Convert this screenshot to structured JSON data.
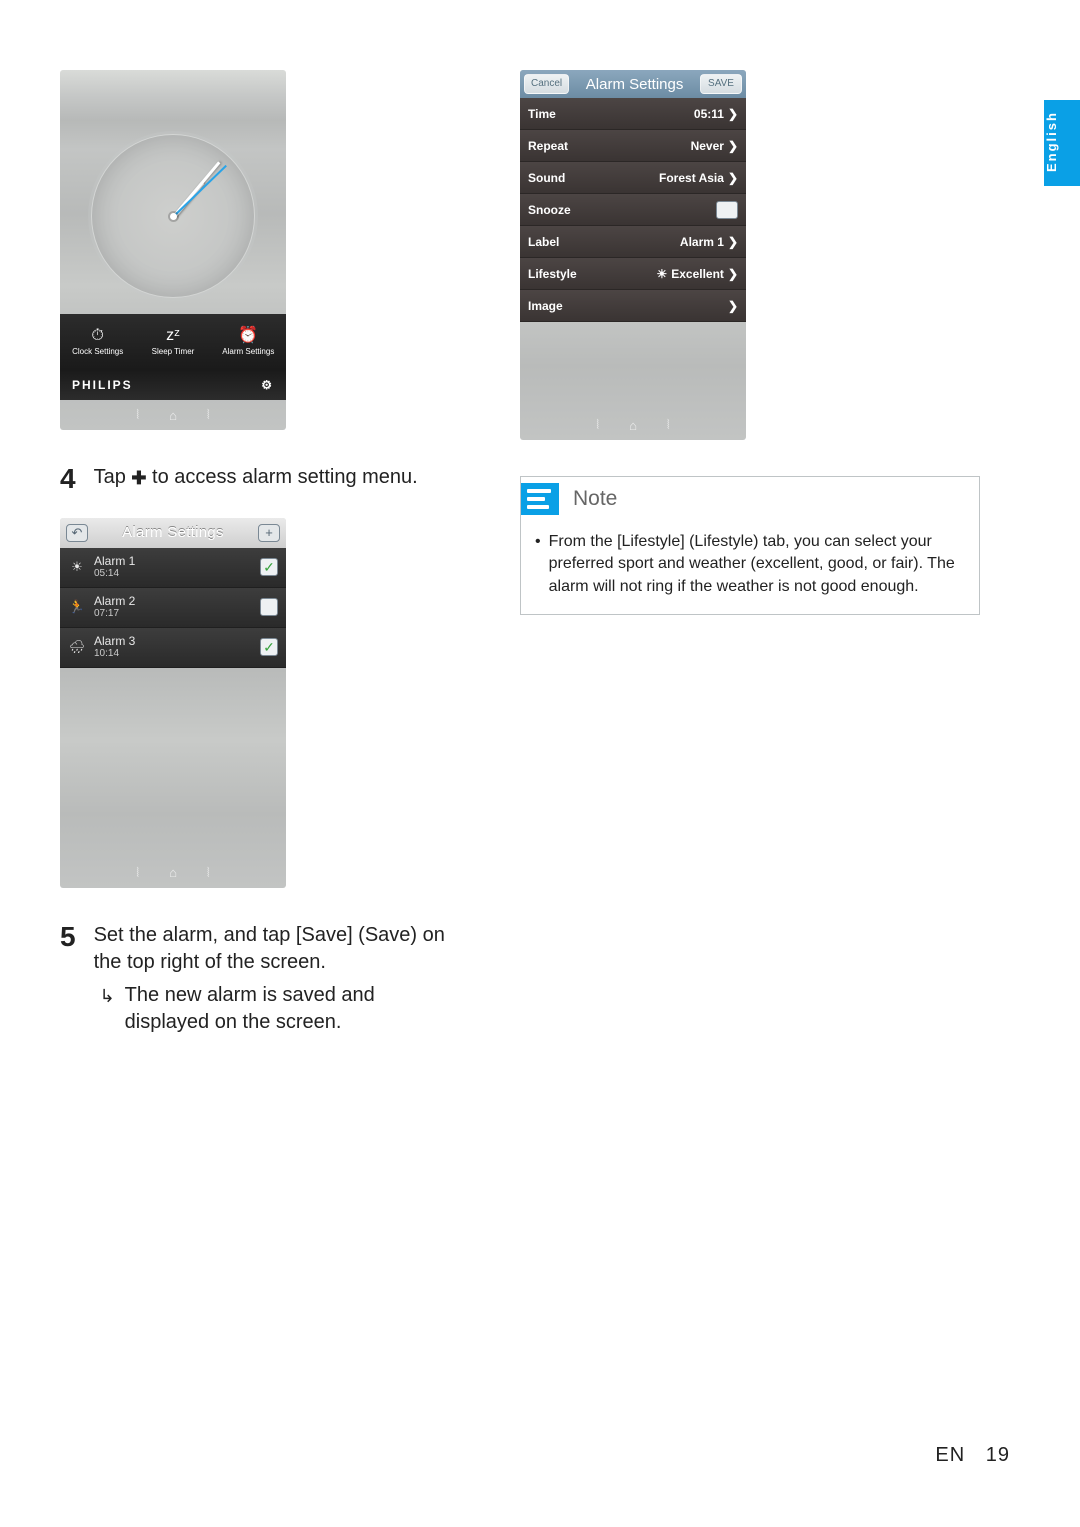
{
  "lang_tab": "English",
  "screenshot1": {
    "tabs": [
      {
        "icon": "⏱",
        "label": "Clock Settings"
      },
      {
        "icon": "zᶻ",
        "label": "Sleep Timer"
      },
      {
        "icon": "⏰",
        "label": "Alarm Settings"
      }
    ],
    "brand": "PHILIPS",
    "gear": "⚙"
  },
  "step4": {
    "num": "4",
    "text_pre": "Tap ",
    "text_post": " to access alarm setting menu."
  },
  "screenshot2": {
    "back": "↶",
    "title": "Alarm Settings",
    "add": "+",
    "alarms": [
      {
        "icon": "☀",
        "name": "Alarm 1",
        "time": "05:14",
        "checked": "✓"
      },
      {
        "icon": "🏃",
        "name": "Alarm 2",
        "time": "07:17",
        "checked": ""
      },
      {
        "icon": "🌧",
        "name": "Alarm 3",
        "time": "10:14",
        "checked": "✓"
      }
    ]
  },
  "step5": {
    "num": "5",
    "text": "Set the alarm, and tap [Save] (Save) on the top right of the screen.",
    "sub": "The new alarm is saved and displayed on the screen."
  },
  "screenshot3": {
    "cancel": "Cancel",
    "title": "Alarm Settings",
    "save": "SAVE",
    "rows": {
      "time": {
        "label": "Time",
        "value": "05:11"
      },
      "repeat": {
        "label": "Repeat",
        "value": "Never"
      },
      "sound": {
        "label": "Sound",
        "value": "Forest Asia"
      },
      "snooze": {
        "label": "Snooze"
      },
      "lbl": {
        "label": "Label",
        "value": "Alarm 1"
      },
      "lifestyle": {
        "label": "Lifestyle",
        "value": "Excellent",
        "pre": "☀"
      },
      "image": {
        "label": "Image"
      }
    }
  },
  "note": {
    "heading": "Note",
    "text": "From the [Lifestyle] (Lifestyle) tab, you can select your preferred sport and weather (excellent, good, or fair). The alarm will not ring if the weather is not good enough."
  },
  "footer": {
    "lang": "EN",
    "page": "19"
  },
  "nav_glyphs": {
    "left": "⦚",
    "center": "⌂",
    "right": "⦚"
  }
}
